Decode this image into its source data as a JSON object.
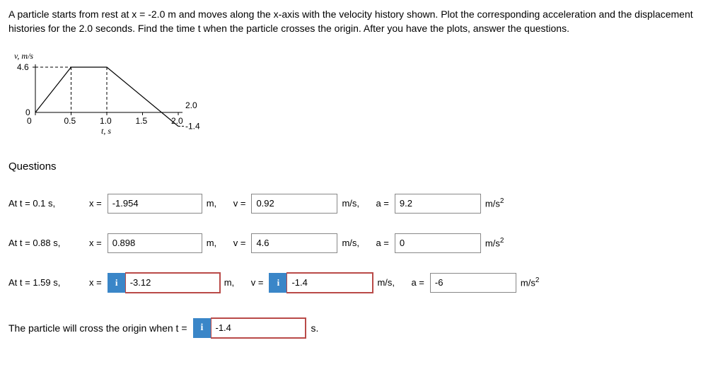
{
  "problem_text": "A particle starts from rest at x = -2.0 m and moves along the x-axis with the velocity history shown. Plot the corresponding acceleration and the displacement histories for the 2.0 seconds. Find the time t when the particle crosses the origin. After you have the plots, answer the questions.",
  "section_title": "Questions",
  "info_glyph": "i",
  "chart_data": {
    "type": "line",
    "xlabel": "t, s",
    "ylabel": "v, m/s",
    "x_ticks": [
      "0",
      "0.5",
      "1.0",
      "1.5",
      "2.0"
    ],
    "y_ticks": [
      "0",
      "4.6"
    ],
    "points": [
      [
        0,
        0
      ],
      [
        0.5,
        4.6
      ],
      [
        1.0,
        4.6
      ],
      [
        2.0,
        -1.4
      ]
    ],
    "annotations": {
      "end_y": "-1.4"
    },
    "xlim": [
      0,
      2.0
    ],
    "ylim": [
      -1.4,
      4.6
    ]
  },
  "rows": [
    {
      "time": "At t = 0.1 s,",
      "x_val": "-1.954",
      "x_err": false,
      "x_info": false,
      "v_val": "0.92",
      "v_err": false,
      "v_info": false,
      "a_val": "9.2",
      "a_err": false,
      "a_info": false
    },
    {
      "time": "At t = 0.88 s,",
      "x_val": "0.898",
      "x_err": false,
      "x_info": false,
      "v_val": "4.6",
      "v_err": false,
      "v_info": false,
      "a_val": "0",
      "a_err": false,
      "a_info": false
    },
    {
      "time": "At t = 1.59 s,",
      "x_val": "-3.12",
      "x_err": true,
      "x_info": true,
      "v_val": "-1.4",
      "v_err": true,
      "v_info": true,
      "a_val": "-6",
      "a_err": false,
      "a_info": false
    }
  ],
  "cross_text": "The particle will cross the origin when t =",
  "cross_val": "-1.4",
  "cross_unit": "s.",
  "labels": {
    "x": "x =",
    "v": "v =",
    "a": "a =",
    "m": "m,",
    "ms": "m/s,",
    "ms2": "m/s"
  }
}
